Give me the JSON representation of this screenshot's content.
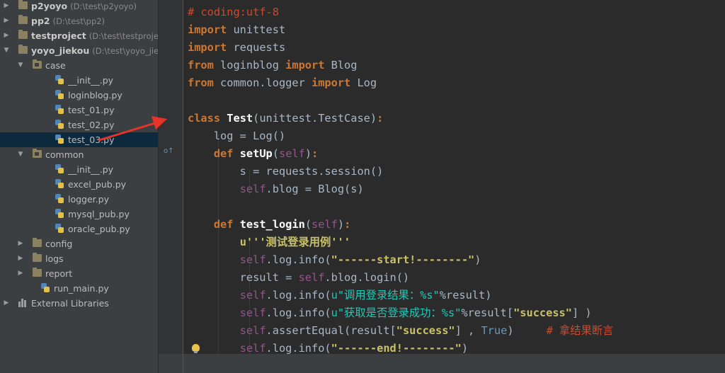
{
  "colors": {
    "keyword": "#cc7832",
    "comment": "#cc4a2e",
    "self": "#94558d",
    "string": "#6a8759",
    "funcname": "#ffc66d",
    "text": "#a9b7c6",
    "true": "#6897bb",
    "bold_string": "#c9c26a",
    "teal": "#20c9b8"
  },
  "tree": [
    {
      "id": "p2yoyo",
      "type": "root",
      "name": "p2yoyo",
      "path": "(D:\\test\\p2yoyo)",
      "expanded": false
    },
    {
      "id": "pp2",
      "type": "root",
      "name": "pp2",
      "path": "(D:\\test\\pp2)",
      "expanded": false
    },
    {
      "id": "testproject",
      "type": "root",
      "name": "testproject",
      "path": "(D:\\test\\testproject)",
      "expanded": false
    },
    {
      "id": "yoyo_jiekou",
      "type": "root",
      "name": "yoyo_jiekou",
      "path": "(D:\\test\\yoyo_jiekou)",
      "expanded": true
    },
    {
      "id": "case",
      "type": "pkg",
      "name": "case",
      "expanded": true
    },
    {
      "id": "case_init",
      "type": "py",
      "name": "__init__.py"
    },
    {
      "id": "loginblog",
      "type": "py",
      "name": "loginblog.py"
    },
    {
      "id": "test01",
      "type": "py",
      "name": "test_01.py"
    },
    {
      "id": "test02",
      "type": "py",
      "name": "test_02.py"
    },
    {
      "id": "test03",
      "type": "py",
      "name": "test_03.py",
      "selected": true
    },
    {
      "id": "common",
      "type": "pkg",
      "name": "common",
      "expanded": true
    },
    {
      "id": "common_init",
      "type": "py",
      "name": "__init__.py"
    },
    {
      "id": "excel_pub",
      "type": "py",
      "name": "excel_pub.py"
    },
    {
      "id": "logger",
      "type": "py",
      "name": "logger.py"
    },
    {
      "id": "mysql_pub",
      "type": "py",
      "name": "mysql_pub.py"
    },
    {
      "id": "oracle_pub",
      "type": "py",
      "name": "oracle_pub.py"
    },
    {
      "id": "config",
      "type": "folder",
      "name": "config",
      "expanded": false
    },
    {
      "id": "logs",
      "type": "folder",
      "name": "logs",
      "expanded": false
    },
    {
      "id": "report",
      "type": "folder",
      "name": "report",
      "expanded": false
    },
    {
      "id": "run_main",
      "type": "py",
      "name": "run_main.py"
    },
    {
      "id": "ext_libs",
      "type": "lib",
      "name": "External Libraries",
      "expanded": false
    }
  ],
  "code": [
    [
      [
        "comment",
        "# coding:utf-8"
      ]
    ],
    [
      [
        "keyword",
        "import"
      ],
      [
        "text",
        " unittest"
      ]
    ],
    [
      [
        "keyword",
        "import"
      ],
      [
        "text",
        " requests"
      ]
    ],
    [
      [
        "keyword",
        "from"
      ],
      [
        "text",
        " loginblog "
      ],
      [
        "keyword",
        "import"
      ],
      [
        "text",
        " Blog"
      ]
    ],
    [
      [
        "keyword",
        "from"
      ],
      [
        "text",
        " common.logger "
      ],
      [
        "keyword",
        "import"
      ],
      [
        "text",
        " Log"
      ]
    ],
    [],
    [
      [
        "keyword",
        "class"
      ],
      [
        "text",
        " "
      ],
      [
        "classname",
        "Test"
      ],
      [
        "text",
        "(unittest.TestCase)"
      ],
      [
        "keyword",
        ":"
      ]
    ],
    [
      [
        "text",
        "    log = Log()"
      ]
    ],
    [
      [
        "text",
        "    "
      ],
      [
        "keyword",
        "def"
      ],
      [
        "text",
        " "
      ],
      [
        "funcname",
        "setUp"
      ],
      [
        "text",
        "("
      ],
      [
        "self",
        "self"
      ],
      [
        "text",
        ")"
      ],
      [
        "keyword",
        ":"
      ]
    ],
    [
      [
        "text",
        "        s = requests.session()"
      ]
    ],
    [
      [
        "text",
        "        "
      ],
      [
        "self",
        "self"
      ],
      [
        "text",
        ".blog = Blog(s)"
      ]
    ],
    [],
    [
      [
        "text",
        "    "
      ],
      [
        "keyword",
        "def"
      ],
      [
        "text",
        " "
      ],
      [
        "funcname",
        "test_login"
      ],
      [
        "text",
        "("
      ],
      [
        "self",
        "self"
      ],
      [
        "text",
        ")"
      ],
      [
        "keyword",
        ":"
      ]
    ],
    [
      [
        "text",
        "        "
      ],
      [
        "bold_string",
        "u'''测试登录用例'''"
      ]
    ],
    [
      [
        "text",
        "        "
      ],
      [
        "self",
        "self"
      ],
      [
        "text",
        ".log.info("
      ],
      [
        "bold_string",
        "\"------start!--------\""
      ],
      [
        "text",
        ")"
      ]
    ],
    [
      [
        "text",
        "        result = "
      ],
      [
        "self",
        "self"
      ],
      [
        "text",
        ".blog.login()"
      ]
    ],
    [
      [
        "text",
        "        "
      ],
      [
        "self",
        "self"
      ],
      [
        "text",
        ".log.info("
      ],
      [
        "teal",
        "u\"调用登录结果：%s\""
      ],
      [
        "text",
        "%result)"
      ]
    ],
    [
      [
        "text",
        "        "
      ],
      [
        "self",
        "self"
      ],
      [
        "text",
        ".log.info("
      ],
      [
        "teal",
        "u\"获取是否登录成功：%s\""
      ],
      [
        "text",
        "%result["
      ],
      [
        "bold_string",
        "\"success\""
      ],
      [
        "text",
        "] )"
      ]
    ],
    [
      [
        "text",
        "        "
      ],
      [
        "self",
        "self"
      ],
      [
        "text",
        ".assertEqual(result["
      ],
      [
        "bold_string",
        "\"success\""
      ],
      [
        "text",
        "] , "
      ],
      [
        "true",
        "True"
      ],
      [
        "text",
        ")     "
      ],
      [
        "comment",
        "# 拿结果断言"
      ]
    ],
    [
      [
        "text",
        "        "
      ],
      [
        "self",
        "self"
      ],
      [
        "text",
        ".log.info("
      ],
      [
        "bold_string",
        "\"------end!--------\""
      ],
      [
        "text",
        ")"
      ]
    ]
  ]
}
